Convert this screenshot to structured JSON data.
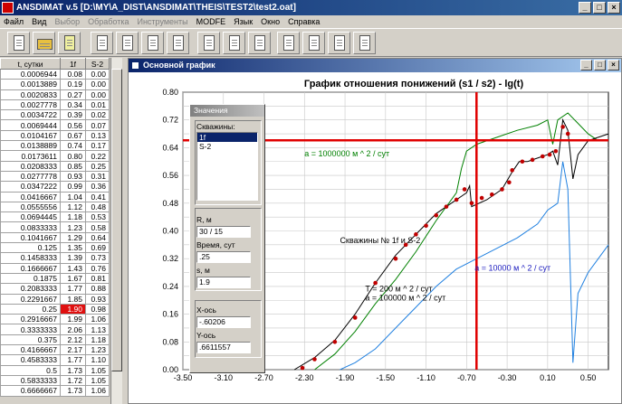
{
  "app": {
    "title": "ANSDIMAT v.5  [D:\\MY\\A_DIST\\ANSDIMAT\\THEIS\\TEST2\\test2.oat]",
    "controls": [
      "_",
      "□",
      "×"
    ]
  },
  "menu": [
    {
      "label": "Файл",
      "enabled": true
    },
    {
      "label": "Вид",
      "enabled": true
    },
    {
      "label": "Выбор",
      "enabled": false
    },
    {
      "label": "Обработка",
      "enabled": false
    },
    {
      "label": "Инструменты",
      "enabled": false
    },
    {
      "label": "MODFE",
      "enabled": true
    },
    {
      "label": "Язык",
      "enabled": true
    },
    {
      "label": "Окно",
      "enabled": true
    },
    {
      "label": "Справка",
      "enabled": true
    }
  ],
  "toolbar": {
    "icons": [
      "new-file-icon",
      "open-folder-icon",
      "edit-pen-icon",
      "doc-icon",
      "doc-icon",
      "doc-icon",
      "doc-icon",
      "doc-chart-icon",
      "doc-chart-icon",
      "doc-chart-icon",
      "doc-chart-icon",
      "doc-chart-icon",
      "doc-chart-icon",
      "doc-blank-icon"
    ]
  },
  "table": {
    "headers": [
      "t, сутки",
      "1f",
      "S-2"
    ],
    "rows": [
      [
        "0.0006944",
        "0.08",
        "0.00"
      ],
      [
        "0.0013889",
        "0.19",
        "0.00"
      ],
      [
        "0.0020833",
        "0.27",
        "0.00"
      ],
      [
        "0.0027778",
        "0.34",
        "0.01"
      ],
      [
        "0.0034722",
        "0.39",
        "0.02"
      ],
      [
        "0.0069444",
        "0.56",
        "0.07"
      ],
      [
        "0.0104167",
        "0.67",
        "0.13"
      ],
      [
        "0.0138889",
        "0.74",
        "0.17"
      ],
      [
        "0.0173611",
        "0.80",
        "0.22"
      ],
      [
        "0.0208333",
        "0.85",
        "0.25"
      ],
      [
        "0.0277778",
        "0.93",
        "0.31"
      ],
      [
        "0.0347222",
        "0.99",
        "0.36"
      ],
      [
        "0.0416667",
        "1.04",
        "0.41"
      ],
      [
        "0.0555556",
        "1.12",
        "0.48"
      ],
      [
        "0.0694445",
        "1.18",
        "0.53"
      ],
      [
        "0.0833333",
        "1.23",
        "0.58"
      ],
      [
        "0.1041667",
        "1.29",
        "0.64"
      ],
      [
        "0.125",
        "1.35",
        "0.69"
      ],
      [
        "0.1458333",
        "1.39",
        "0.73"
      ],
      [
        "0.1666667",
        "1.43",
        "0.76"
      ],
      [
        "0.1875",
        "1.67",
        "0.81"
      ],
      [
        "0.2083333",
        "1.77",
        "0.88"
      ],
      [
        "0.2291667",
        "1.85",
        "0.93"
      ],
      [
        "0.25",
        "1.90",
        "0.98"
      ],
      [
        "0.2916667",
        "1.99",
        "1.06"
      ],
      [
        "0.3333333",
        "2.06",
        "1.13"
      ],
      [
        "0.375",
        "2.12",
        "1.18"
      ],
      [
        "0.4166667",
        "2.17",
        "1.23"
      ],
      [
        "0.4583333",
        "1.77",
        "1.10"
      ],
      [
        "0.5",
        "1.73",
        "1.05"
      ],
      [
        "0.5833333",
        "1.72",
        "1.05"
      ],
      [
        "0.6666667",
        "1.73",
        "1.06"
      ]
    ],
    "selected_row": 23,
    "selected_col": 1
  },
  "graph_window": {
    "title": "Основной график",
    "controls": [
      "_",
      "□",
      "×"
    ]
  },
  "dialog": {
    "title": "Значения",
    "wells_label": "Скважины:",
    "wells": [
      "1f",
      "S-2"
    ],
    "selected_well": "1f",
    "r_label": "R, м",
    "r_value": "30 / 15",
    "time_label": "Время, сут",
    "time_value": ".25",
    "s_label": "s, м",
    "s_value": "1.9",
    "x_label": "X-ось",
    "x_value": "-.60206",
    "y_label": "Y-ось",
    "y_value": ".6611557"
  },
  "chart_data": {
    "type": "line",
    "title": "График отношения понижений (s1 / s2) - lg(t)",
    "xlim": [
      -3.5,
      0.7
    ],
    "ylim": [
      0.0,
      0.8
    ],
    "x_ticks": [
      "-3.50",
      "-3.10",
      "-2.70",
      "-2.30",
      "-1.90",
      "-1.50",
      "-1.10",
      "-0.70",
      "-0.30",
      "0.10",
      "0.50"
    ],
    "y_ticks": [
      "0.00",
      "0.04",
      "0.08",
      "0.12",
      "0.16",
      "0.20",
      "0.24",
      "0.28",
      "0.32",
      "0.36",
      "0.40",
      "0.44",
      "0.48",
      "0.52",
      "0.56",
      "0.60",
      "0.64",
      "0.68",
      "0.72",
      "0.76",
      "0.80"
    ],
    "grid": true,
    "crosshair": {
      "x": -0.60206,
      "y": 0.6611557,
      "color": "#e00000"
    },
    "series": [
      {
        "color": "#008000",
        "points": [
          [
            -2.2,
            0.0
          ],
          [
            -2.0,
            0.045
          ],
          [
            -1.8,
            0.11
          ],
          [
            -1.6,
            0.19
          ],
          [
            -1.4,
            0.26
          ],
          [
            -1.2,
            0.34
          ],
          [
            -1.0,
            0.43
          ],
          [
            -0.8,
            0.51
          ],
          [
            -0.75,
            0.58
          ],
          [
            -0.7,
            0.63
          ],
          [
            -0.6,
            0.65
          ],
          [
            -0.4,
            0.67
          ],
          [
            -0.2,
            0.69
          ],
          [
            0.0,
            0.705
          ],
          [
            0.1,
            0.72
          ],
          [
            0.15,
            0.65
          ],
          [
            0.2,
            0.72
          ],
          [
            0.3,
            0.74
          ],
          [
            0.4,
            0.71
          ],
          [
            0.5,
            0.68
          ],
          [
            0.6,
            0.66
          ],
          [
            0.7,
            0.66
          ]
        ]
      },
      {
        "color": "#000000",
        "points": [
          [
            -2.4,
            0.0
          ],
          [
            -2.2,
            0.035
          ],
          [
            -2.0,
            0.085
          ],
          [
            -1.8,
            0.16
          ],
          [
            -1.6,
            0.25
          ],
          [
            -1.4,
            0.33
          ],
          [
            -1.2,
            0.39
          ],
          [
            -1.0,
            0.45
          ],
          [
            -0.85,
            0.48
          ],
          [
            -0.7,
            0.51
          ],
          [
            -0.67,
            0.53
          ],
          [
            -0.65,
            0.47
          ],
          [
            -0.5,
            0.49
          ],
          [
            -0.35,
            0.52
          ],
          [
            -0.25,
            0.57
          ],
          [
            -0.18,
            0.6
          ],
          [
            -0.1,
            0.6
          ],
          [
            0.0,
            0.61
          ],
          [
            0.1,
            0.62
          ],
          [
            0.15,
            0.63
          ],
          [
            0.2,
            0.59
          ],
          [
            0.25,
            0.72
          ],
          [
            0.3,
            0.69
          ],
          [
            0.35,
            0.55
          ],
          [
            0.4,
            0.62
          ],
          [
            0.5,
            0.66
          ],
          [
            0.6,
            0.67
          ],
          [
            0.7,
            0.68
          ]
        ]
      },
      {
        "color": "#2080e0",
        "points": [
          [
            -1.95,
            0.0
          ],
          [
            -1.8,
            0.02
          ],
          [
            -1.6,
            0.06
          ],
          [
            -1.4,
            0.12
          ],
          [
            -1.2,
            0.18
          ],
          [
            -1.0,
            0.24
          ],
          [
            -0.8,
            0.29
          ],
          [
            -0.6,
            0.32
          ],
          [
            -0.4,
            0.35
          ],
          [
            -0.2,
            0.38
          ],
          [
            0.0,
            0.42
          ],
          [
            0.1,
            0.46
          ],
          [
            0.2,
            0.48
          ],
          [
            0.25,
            0.6
          ],
          [
            0.3,
            0.52
          ],
          [
            0.35,
            0.02
          ],
          [
            0.4,
            0.22
          ],
          [
            0.5,
            0.28
          ],
          [
            0.6,
            0.32
          ],
          [
            0.7,
            0.36
          ]
        ]
      }
    ],
    "markers": {
      "color": "#c00000",
      "points": [
        [
          -2.32,
          0.005
        ],
        [
          -2.2,
          0.03
        ],
        [
          -2.0,
          0.08
        ],
        [
          -1.8,
          0.15
        ],
        [
          -1.6,
          0.25
        ],
        [
          -1.4,
          0.32
        ],
        [
          -1.3,
          0.36
        ],
        [
          -1.2,
          0.39
        ],
        [
          -1.1,
          0.415
        ],
        [
          -1.0,
          0.445
        ],
        [
          -0.9,
          0.47
        ],
        [
          -0.8,
          0.49
        ],
        [
          -0.72,
          0.52
        ],
        [
          -0.65,
          0.48
        ],
        [
          -0.55,
          0.495
        ],
        [
          -0.45,
          0.505
        ],
        [
          -0.35,
          0.52
        ],
        [
          -0.28,
          0.54
        ],
        [
          -0.25,
          0.575
        ],
        [
          -0.15,
          0.6
        ],
        [
          -0.05,
          0.605
        ],
        [
          0.05,
          0.615
        ],
        [
          0.12,
          0.62
        ],
        [
          0.18,
          0.63
        ],
        [
          0.25,
          0.7
        ],
        [
          0.3,
          0.68
        ]
      ]
    },
    "annotations": [
      {
        "text": "a = 1000000  м ^ 2 / сут",
        "x": -2.3,
        "y": 0.615,
        "color": "#008000"
      },
      {
        "text": "Скважины № 1f и S-2",
        "x": -1.95,
        "y": 0.365,
        "color": "#000000"
      },
      {
        "text": "T = 200  м ^ 2 / сут",
        "x": -1.7,
        "y": 0.225,
        "color": "#000000"
      },
      {
        "text": "a = 100000  м ^ 2 / сут",
        "x": -1.7,
        "y": 0.2,
        "color": "#000000"
      },
      {
        "text": "a = 10000  м ^ 2 / сут",
        "x": -0.62,
        "y": 0.285,
        "color": "#2020c0"
      }
    ]
  }
}
